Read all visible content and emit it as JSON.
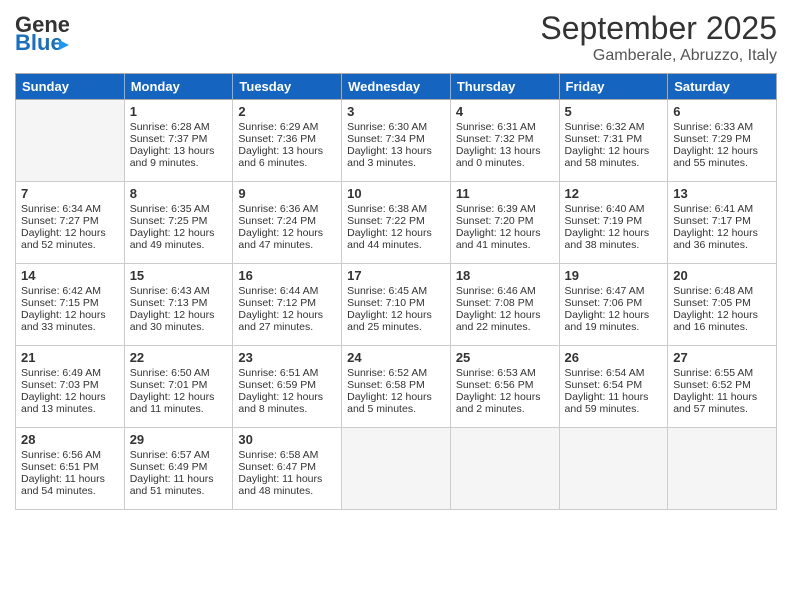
{
  "header": {
    "logo_general": "General",
    "logo_blue": "Blue",
    "month": "September 2025",
    "location": "Gamberale, Abruzzo, Italy"
  },
  "weekdays": [
    "Sunday",
    "Monday",
    "Tuesday",
    "Wednesday",
    "Thursday",
    "Friday",
    "Saturday"
  ],
  "weeks": [
    [
      {
        "day": "",
        "info": ""
      },
      {
        "day": "1",
        "info": "Sunrise: 6:28 AM\nSunset: 7:37 PM\nDaylight: 13 hours\nand 9 minutes."
      },
      {
        "day": "2",
        "info": "Sunrise: 6:29 AM\nSunset: 7:36 PM\nDaylight: 13 hours\nand 6 minutes."
      },
      {
        "day": "3",
        "info": "Sunrise: 6:30 AM\nSunset: 7:34 PM\nDaylight: 13 hours\nand 3 minutes."
      },
      {
        "day": "4",
        "info": "Sunrise: 6:31 AM\nSunset: 7:32 PM\nDaylight: 13 hours\nand 0 minutes."
      },
      {
        "day": "5",
        "info": "Sunrise: 6:32 AM\nSunset: 7:31 PM\nDaylight: 12 hours\nand 58 minutes."
      },
      {
        "day": "6",
        "info": "Sunrise: 6:33 AM\nSunset: 7:29 PM\nDaylight: 12 hours\nand 55 minutes."
      }
    ],
    [
      {
        "day": "7",
        "info": "Sunrise: 6:34 AM\nSunset: 7:27 PM\nDaylight: 12 hours\nand 52 minutes."
      },
      {
        "day": "8",
        "info": "Sunrise: 6:35 AM\nSunset: 7:25 PM\nDaylight: 12 hours\nand 49 minutes."
      },
      {
        "day": "9",
        "info": "Sunrise: 6:36 AM\nSunset: 7:24 PM\nDaylight: 12 hours\nand 47 minutes."
      },
      {
        "day": "10",
        "info": "Sunrise: 6:38 AM\nSunset: 7:22 PM\nDaylight: 12 hours\nand 44 minutes."
      },
      {
        "day": "11",
        "info": "Sunrise: 6:39 AM\nSunset: 7:20 PM\nDaylight: 12 hours\nand 41 minutes."
      },
      {
        "day": "12",
        "info": "Sunrise: 6:40 AM\nSunset: 7:19 PM\nDaylight: 12 hours\nand 38 minutes."
      },
      {
        "day": "13",
        "info": "Sunrise: 6:41 AM\nSunset: 7:17 PM\nDaylight: 12 hours\nand 36 minutes."
      }
    ],
    [
      {
        "day": "14",
        "info": "Sunrise: 6:42 AM\nSunset: 7:15 PM\nDaylight: 12 hours\nand 33 minutes."
      },
      {
        "day": "15",
        "info": "Sunrise: 6:43 AM\nSunset: 7:13 PM\nDaylight: 12 hours\nand 30 minutes."
      },
      {
        "day": "16",
        "info": "Sunrise: 6:44 AM\nSunset: 7:12 PM\nDaylight: 12 hours\nand 27 minutes."
      },
      {
        "day": "17",
        "info": "Sunrise: 6:45 AM\nSunset: 7:10 PM\nDaylight: 12 hours\nand 25 minutes."
      },
      {
        "day": "18",
        "info": "Sunrise: 6:46 AM\nSunset: 7:08 PM\nDaylight: 12 hours\nand 22 minutes."
      },
      {
        "day": "19",
        "info": "Sunrise: 6:47 AM\nSunset: 7:06 PM\nDaylight: 12 hours\nand 19 minutes."
      },
      {
        "day": "20",
        "info": "Sunrise: 6:48 AM\nSunset: 7:05 PM\nDaylight: 12 hours\nand 16 minutes."
      }
    ],
    [
      {
        "day": "21",
        "info": "Sunrise: 6:49 AM\nSunset: 7:03 PM\nDaylight: 12 hours\nand 13 minutes."
      },
      {
        "day": "22",
        "info": "Sunrise: 6:50 AM\nSunset: 7:01 PM\nDaylight: 12 hours\nand 11 minutes."
      },
      {
        "day": "23",
        "info": "Sunrise: 6:51 AM\nSunset: 6:59 PM\nDaylight: 12 hours\nand 8 minutes."
      },
      {
        "day": "24",
        "info": "Sunrise: 6:52 AM\nSunset: 6:58 PM\nDaylight: 12 hours\nand 5 minutes."
      },
      {
        "day": "25",
        "info": "Sunrise: 6:53 AM\nSunset: 6:56 PM\nDaylight: 12 hours\nand 2 minutes."
      },
      {
        "day": "26",
        "info": "Sunrise: 6:54 AM\nSunset: 6:54 PM\nDaylight: 11 hours\nand 59 minutes."
      },
      {
        "day": "27",
        "info": "Sunrise: 6:55 AM\nSunset: 6:52 PM\nDaylight: 11 hours\nand 57 minutes."
      }
    ],
    [
      {
        "day": "28",
        "info": "Sunrise: 6:56 AM\nSunset: 6:51 PM\nDaylight: 11 hours\nand 54 minutes."
      },
      {
        "day": "29",
        "info": "Sunrise: 6:57 AM\nSunset: 6:49 PM\nDaylight: 11 hours\nand 51 minutes."
      },
      {
        "day": "30",
        "info": "Sunrise: 6:58 AM\nSunset: 6:47 PM\nDaylight: 11 hours\nand 48 minutes."
      },
      {
        "day": "",
        "info": ""
      },
      {
        "day": "",
        "info": ""
      },
      {
        "day": "",
        "info": ""
      },
      {
        "day": "",
        "info": ""
      }
    ]
  ]
}
